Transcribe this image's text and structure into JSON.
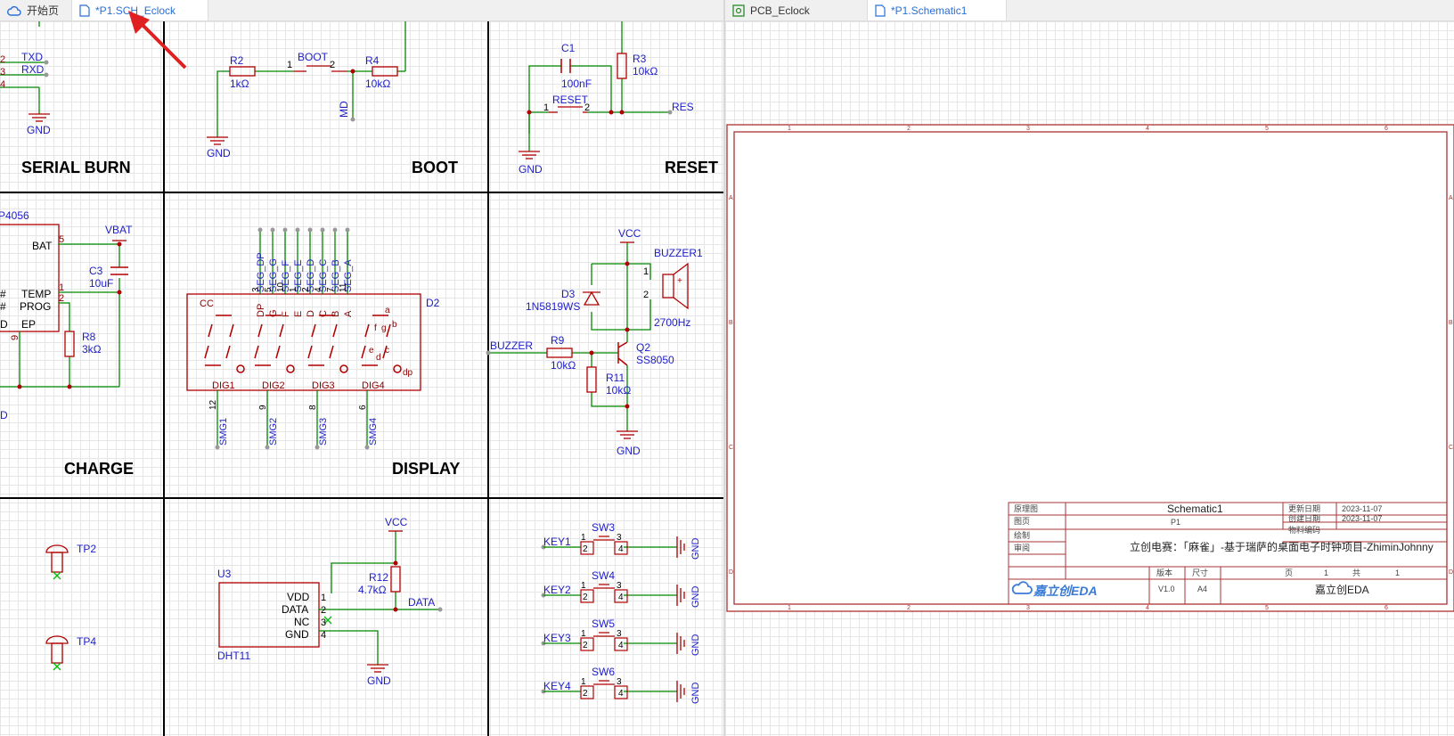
{
  "left_tabs": [
    {
      "label": "开始页",
      "icon": "cloud-icon"
    },
    {
      "label": "*P1.SCH_Eclock",
      "icon": "document-icon",
      "active": true
    }
  ],
  "right_tabs": [
    {
      "label": "PCB_Eclock",
      "icon": "pcb-icon"
    },
    {
      "label": "*P1.Schematic1",
      "icon": "document-icon",
      "active": true
    }
  ],
  "colors": {
    "wire": "#008800",
    "part": "#b00000",
    "label": "#1d1dc8",
    "pin": "#8b0000",
    "frame": "#a33"
  },
  "blocks": {
    "serial_burn": {
      "title": "SERIAL BURN",
      "txd": "TXD",
      "rxd": "RXD",
      "gnd": "GND",
      "pins": [
        "2",
        "3",
        "4"
      ]
    },
    "boot": {
      "title": "BOOT",
      "r2": "R2",
      "r2_val": "1kΩ",
      "r4": "R4",
      "r4_val": "10kΩ",
      "sw": "BOOT",
      "p1": "1",
      "p2": "2",
      "md": "MD",
      "gnd": "GND"
    },
    "reset": {
      "title": "RESET",
      "c1": "C1",
      "c1_val": "100nF",
      "r3": "R3",
      "r3_val": "10kΩ",
      "sw": "RESET",
      "p1": "1",
      "p2": "2",
      "net": "RES",
      "gnd": "GND"
    },
    "charge": {
      "title": "CHARGE",
      "ic": "P4056",
      "bat": "BAT",
      "temp": "TEMP",
      "prog": "PROG",
      "ep": "EP",
      "hash1": "#",
      "hash2": "#",
      "d1": "D",
      "d2": "D",
      "p5": "5",
      "p1": "1",
      "p2": "2",
      "p9": "9",
      "vbat": "VBAT",
      "c3": "C3",
      "c3_val": "10uF",
      "r8": "R8",
      "r8_val": "3kΩ"
    },
    "display": {
      "title": "DISPLAY",
      "cc": "CC",
      "ref": "D2",
      "seg_nets": [
        "SEG_DP",
        "SEG_G",
        "SEG_F",
        "SEG_E",
        "SEG_D",
        "SEG_C",
        "SEG_B",
        "SEG_A"
      ],
      "seg_pins": [
        "3",
        "5",
        "10",
        "1",
        "2",
        "4",
        "7",
        "11"
      ],
      "seg_names": [
        "DP",
        "G",
        "F",
        "E",
        "D",
        "C",
        "B",
        "A"
      ],
      "digits": [
        "DIG1",
        "DIG2",
        "DIG3",
        "DIG4"
      ],
      "dig_pins": [
        "12",
        "9",
        "8",
        "6"
      ],
      "smg": [
        "SMG1",
        "SMG2",
        "SMG3",
        "SMG4"
      ],
      "seg_letters": {
        "a": "a",
        "b": "b",
        "c": "c",
        "d": "d",
        "e": "e",
        "f": "f",
        "g": "g",
        "dp": "dp"
      }
    },
    "buzzer": {
      "vcc": "VCC",
      "ref": "BUZZER1",
      "freq": "2700Hz",
      "p1": "1",
      "p2": "2",
      "plus": "+",
      "d3": "D3",
      "d3_val": "1N5819WS",
      "net": "BUZZER",
      "r9": "R9",
      "r9_val": "10kΩ",
      "q2": "Q2",
      "q2_val": "SS8050",
      "r11": "R11",
      "r11_val": "10kΩ",
      "gnd": "GND"
    },
    "tp": {
      "tp2": "TP2",
      "tp4": "TP4"
    },
    "dht": {
      "vcc": "VCC",
      "u3": "U3",
      "part": "DHT11",
      "vdd": "VDD",
      "data": "DATA",
      "nc": "NC",
      "gnd_pin": "GND",
      "pins": [
        "1",
        "2",
        "3",
        "4"
      ],
      "r12": "R12",
      "r12_val": "4.7kΩ",
      "net": "DATA",
      "gnd": "GND"
    },
    "keys": {
      "items": [
        {
          "sw": "SW3",
          "key": "KEY1"
        },
        {
          "sw": "SW4",
          "key": "KEY2"
        },
        {
          "sw": "SW5",
          "key": "KEY3"
        },
        {
          "sw": "SW6",
          "key": "KEY4"
        }
      ],
      "p1": "1",
      "p2": "2",
      "p3": "3",
      "p4": "4",
      "gnd": "GND"
    }
  },
  "title_block": {
    "rows_left": [
      "原理图",
      "图页",
      "绘制",
      "审阅"
    ],
    "name": "Schematic1",
    "page": "P1",
    "project": "立创电赛：「麻雀」-基于瑞萨的桌面电子时钟项目-ZhiminJohnny",
    "logo": "嘉立创EDA",
    "version_label": "版本",
    "version": "V1.0",
    "size_label": "尺寸",
    "size": "A4",
    "page_label": "页",
    "page_no": "1",
    "total_label": "共",
    "total": "1",
    "company": "嘉立创EDA",
    "updated_label": "更新日期",
    "updated": "2023-11-07",
    "created_label": "创建日期",
    "created": "2023-11-07",
    "material_label": "物料编码"
  },
  "border_marks": {
    "cols": [
      "1",
      "2",
      "3",
      "4",
      "5",
      "6"
    ],
    "rows": [
      "A",
      "B",
      "C",
      "D"
    ]
  }
}
